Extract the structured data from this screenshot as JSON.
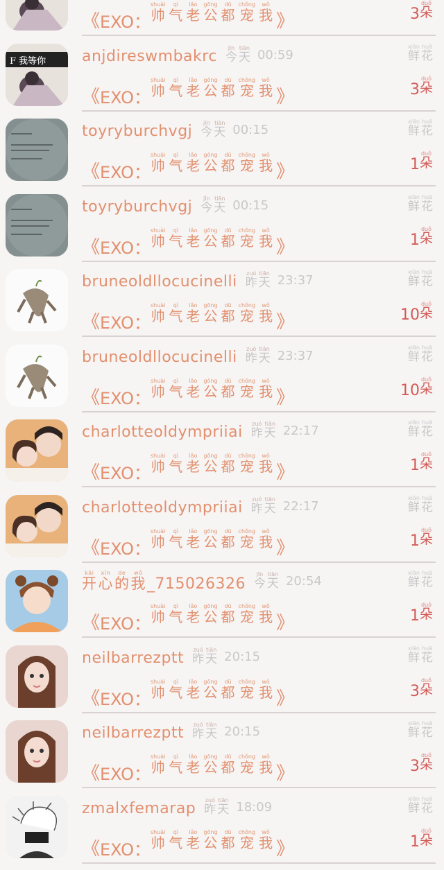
{
  "gift_title": {
    "open_bracket": "《",
    "prefix": "EXO：",
    "words": [
      {
        "py": "shuài",
        "hz": "帅"
      },
      {
        "py": "qì",
        "hz": "气"
      },
      {
        "py": "lǎo",
        "hz": "老"
      },
      {
        "py": "gōng",
        "hz": "公"
      },
      {
        "py": "dū",
        "hz": "都"
      },
      {
        "py": "chǒng",
        "hz": "宠"
      },
      {
        "py": "wǒ",
        "hz": "我"
      }
    ],
    "close_bracket": "》"
  },
  "flower_label": [
    {
      "py": "xiān",
      "hz": "鲜"
    },
    {
      "py": "huā",
      "hz": "花"
    }
  ],
  "unit": {
    "py": "duǒ",
    "hz": "朵"
  },
  "day_labels": {
    "today": [
      {
        "py": "jīn",
        "hz": "今"
      },
      {
        "py": "tiān",
        "hz": "天"
      }
    ],
    "yesterday": [
      {
        "py": "zuó",
        "hz": "昨"
      },
      {
        "py": "tiān",
        "hz": "天"
      }
    ]
  },
  "rows": [
    {
      "user": "",
      "day": "",
      "time": "",
      "count": "3",
      "avatar": "photo-f"
    },
    {
      "user": "anjdireswmbakrc",
      "day": "today",
      "time": "00:59",
      "count": "3",
      "avatar": "photo-f"
    },
    {
      "user": "toyryburchvgj",
      "day": "today",
      "time": "00:15",
      "count": "1",
      "avatar": "notebook"
    },
    {
      "user": "toyryburchvgj",
      "day": "today",
      "time": "00:15",
      "count": "1",
      "avatar": "notebook"
    },
    {
      "user": "bruneoldllocucinelli",
      "day": "yesterday",
      "time": "23:37",
      "count": "10",
      "avatar": "cat"
    },
    {
      "user": "bruneoldllocucinelli",
      "day": "yesterday",
      "time": "23:37",
      "count": "10",
      "avatar": "cat"
    },
    {
      "user": "charlotteoldympriiai",
      "day": "yesterday",
      "time": "22:17",
      "count": "1",
      "avatar": "couple"
    },
    {
      "user": "charlotteoldympriiai",
      "day": "yesterday",
      "time": "22:17",
      "count": "1",
      "avatar": "couple"
    },
    {
      "user": "开心的我_715026326",
      "user_pinyin": [
        {
          "py": "kāi",
          "hz": "开"
        },
        {
          "py": "xīn",
          "hz": "心"
        },
        {
          "py": "de",
          "hz": "的"
        },
        {
          "py": "wǒ",
          "hz": "我"
        }
      ],
      "user_suffix": "_715026326",
      "day": "today",
      "time": "20:54",
      "count": "1",
      "avatar": "bear"
    },
    {
      "user": "neilbarrezptt",
      "day": "yesterday",
      "time": "20:15",
      "count": "3",
      "avatar": "girl"
    },
    {
      "user": "neilbarrezptt",
      "day": "yesterday",
      "time": "20:15",
      "count": "3",
      "avatar": "girl"
    },
    {
      "user": "zmalxfemarap",
      "day": "yesterday",
      "time": "18:09",
      "count": "1",
      "avatar": "sketch"
    }
  ],
  "photo_f_text": "F  我等你",
  "colors": {
    "accent": "#e2906e",
    "count": "#d35b56",
    "muted": "#c7c7c7",
    "separator": "#d9d2d2"
  }
}
